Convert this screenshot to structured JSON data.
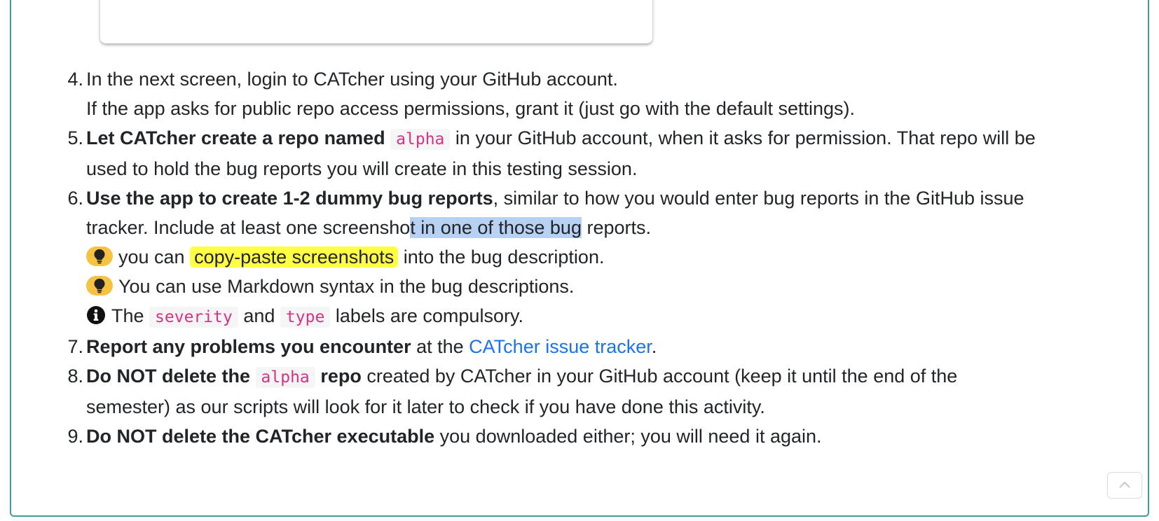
{
  "steps": [
    {
      "number": "4.",
      "line1": "In the next screen, login to CATcher using your GitHub account.",
      "line2": "If the app asks for public repo access permissions, grant it (just go with the default settings)."
    },
    {
      "number": "5.",
      "bold": "Let CATcher create a repo named",
      "code": "alpha",
      "text_after_code": "in your GitHub account, when it asks for permission. That repo will be",
      "line2": "used to hold the bug reports you will create in this testing session."
    },
    {
      "number": "6.",
      "bold": "Use the app to create 1-2 dummy bug reports",
      "text_after_bold": ", similar to how you would enter bug reports in the GitHub issue",
      "line2_before_selection": "tracker. Include at least one screensho",
      "line2_selected": "t in one of those bug",
      "line2_after_selection": " reports.",
      "tip1_before": "you can",
      "tip1_highlight": "copy-paste screenshots",
      "tip1_after": "into the bug description.",
      "tip2": "You can use Markdown syntax in the bug descriptions.",
      "info_before": "The",
      "info_code1": "severity",
      "info_middle": "and",
      "info_code2": "type",
      "info_after": "labels are compulsory."
    },
    {
      "number": "7.",
      "bold": "Report any problems you encounter",
      "text_before_link": "at the",
      "link": "CATcher issue tracker",
      "text_after_link": "."
    },
    {
      "number": "8.",
      "bold_before_code": "Do NOT delete the",
      "code": "alpha",
      "bold_after_code": "repo",
      "text_after": "created by CATcher in your GitHub account (keep it until the end of the",
      "line2": "semester) as our scripts will look for it later to check if you have done this activity."
    },
    {
      "number": "9.",
      "bold": "Do NOT delete the CATcher executable",
      "text_after": "you downloaded either; you will need it again."
    }
  ],
  "icons": {
    "tip": "lightbulb-icon",
    "info": "info-circle-icon",
    "scroll_top": "chevron-up-icon"
  },
  "colors": {
    "panel_border": "#3c9d9b",
    "link": "#1a73e8",
    "code_text": "#d63384",
    "highlight": "#ffff44",
    "selection": "#b7d1f2",
    "tip_badge": "#f5c242"
  }
}
